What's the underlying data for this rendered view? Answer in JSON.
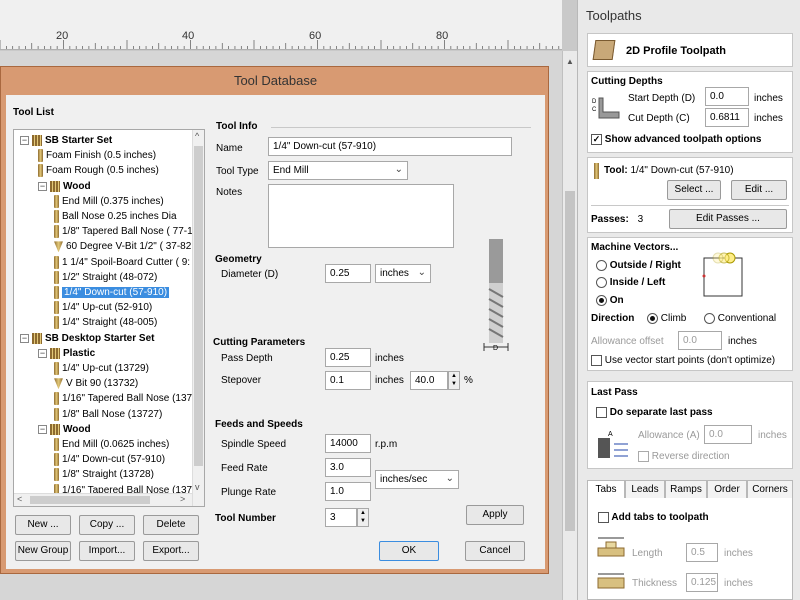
{
  "ruler": {
    "marks": [
      "20",
      "40",
      "60",
      "80"
    ]
  },
  "dialog": {
    "title": "Tool Database",
    "tool_list_label": "Tool List",
    "tree": [
      {
        "text": "SB Starter Set",
        "level": 0,
        "type": "root"
      },
      {
        "text": "Foam Finish (0.5 inches)",
        "level": 1,
        "type": "tool"
      },
      {
        "text": "Foam Rough (0.5 inches)",
        "level": 1,
        "type": "tool"
      },
      {
        "text": "Wood",
        "level": 1,
        "type": "group"
      },
      {
        "text": "End Mill (0.375 inches)",
        "level": 2,
        "type": "tool"
      },
      {
        "text": "Ball Nose 0.25 inches Dia",
        "level": 2,
        "type": "tool"
      },
      {
        "text": "1/8\" Tapered Ball Nose ( 77-1",
        "level": 2,
        "type": "tool"
      },
      {
        "text": "60 Degree V-Bit 1/2\"  ( 37-82",
        "level": 2,
        "type": "vbit"
      },
      {
        "text": "1 1/4\" Spoil-Board Cutter ( 9:",
        "level": 2,
        "type": "tool"
      },
      {
        "text": "1/2\" Straight  (48-072)",
        "level": 2,
        "type": "tool"
      },
      {
        "text": "1/4\"  Down-cut (57-910)",
        "level": 2,
        "type": "tool",
        "selected": true
      },
      {
        "text": "1/4\" Up-cut (52-910)",
        "level": 2,
        "type": "tool"
      },
      {
        "text": "1/4\" Straight  (48-005)",
        "level": 2,
        "type": "tool"
      },
      {
        "text": "SB Desktop Starter Set",
        "level": 0,
        "type": "root"
      },
      {
        "text": "Plastic",
        "level": 1,
        "type": "group"
      },
      {
        "text": "1/4\" Up-cut (13729)",
        "level": 2,
        "type": "tool"
      },
      {
        "text": "V Bit 90 (13732)",
        "level": 2,
        "type": "vbit"
      },
      {
        "text": "1/16\" Tapered Ball Nose (137",
        "level": 2,
        "type": "tool"
      },
      {
        "text": "1/8\" Ball Nose (13727)",
        "level": 2,
        "type": "tool"
      },
      {
        "text": "Wood",
        "level": 1,
        "type": "group"
      },
      {
        "text": "End Mill (0.0625 inches)",
        "level": 2,
        "type": "tool"
      },
      {
        "text": "1/4\"  Down-cut (57-910)",
        "level": 2,
        "type": "tool"
      },
      {
        "text": "1/8\" Straight (13728)",
        "level": 2,
        "type": "tool"
      },
      {
        "text": "1/16\" Tapered Ball Nose (137",
        "level": 2,
        "type": "tool"
      }
    ],
    "buttons": {
      "new": "New ...",
      "copy": "Copy ...",
      "delete": "Delete",
      "new_group": "New Group",
      "import": "Import...",
      "export": "Export...",
      "apply": "Apply",
      "ok": "OK",
      "cancel": "Cancel"
    },
    "tool_info": {
      "heading": "Tool Info",
      "name_label": "Name",
      "name_value": "1/4\"  Down-cut (57-910)",
      "type_label": "Tool Type",
      "type_value": "End Mill",
      "notes_label": "Notes",
      "notes_value": ""
    },
    "geometry": {
      "heading": "Geometry",
      "diameter_label": "Diameter (D)",
      "diameter_value": "0.25",
      "units": "inches",
      "diagram_label": "D"
    },
    "cutting": {
      "heading": "Cutting Parameters",
      "pass_depth_label": "Pass Depth",
      "pass_depth_value": "0.25",
      "pass_depth_units": "inches",
      "stepover_label": "Stepover",
      "stepover_value": "0.1",
      "stepover_units": "inches",
      "stepover_pct": "40.0",
      "pct_sign": "%"
    },
    "feeds": {
      "heading": "Feeds and Speeds",
      "spindle_label": "Spindle Speed",
      "spindle_value": "14000",
      "spindle_units": "r.p.m",
      "feed_label": "Feed Rate",
      "feed_value": "3.0",
      "plunge_label": "Plunge Rate",
      "plunge_value": "1.0",
      "rate_units": "inches/sec"
    },
    "tool_number": {
      "label": "Tool Number",
      "value": "3"
    }
  },
  "toolpaths": {
    "title": "Toolpaths",
    "op_title": "2D Profile Toolpath",
    "cutting_depths": {
      "heading": "Cutting Depths",
      "start_label": "Start Depth (D)",
      "start_value": "0.0",
      "cut_label": "Cut Depth (C)",
      "cut_value": "0.6811",
      "units": "inches",
      "show_advanced": "Show advanced toolpath options",
      "diagram_d": "D",
      "diagram_c": "C"
    },
    "tool": {
      "label": "Tool:",
      "value": "1/4\"  Down-cut (57-910)",
      "select": "Select ...",
      "edit": "Edit ...",
      "passes_label": "Passes:",
      "passes_value": "3",
      "edit_passes": "Edit Passes ..."
    },
    "machine_vectors": {
      "heading": "Machine Vectors...",
      "outside": "Outside / Right",
      "inside": "Inside / Left",
      "on": "On",
      "direction_label": "Direction",
      "climb": "Climb",
      "conventional": "Conventional",
      "allowance_label": "Allowance offset",
      "allowance_value": "0.0",
      "allowance_units": "inches",
      "vector_start": "Use vector start points (don't optimize)"
    },
    "last_pass": {
      "heading": "Last Pass",
      "separate": "Do separate last pass",
      "allowance_label": "Allowance (A)",
      "allowance_value": "0.0",
      "units": "inches",
      "reverse": "Reverse direction",
      "diagram_a": "A"
    },
    "tabs": [
      "Tabs",
      "Leads",
      "Ramps",
      "Order",
      "Corners"
    ],
    "tabs_panel": {
      "add_tabs": "Add tabs to toolpath",
      "length_label": "Length",
      "length_value": "0.5",
      "thickness_label": "Thickness",
      "thickness_value": "0.125",
      "units": "inches"
    }
  },
  "colors": {
    "dialog_frame": "#d89a72",
    "selection": "#3b8de0"
  }
}
